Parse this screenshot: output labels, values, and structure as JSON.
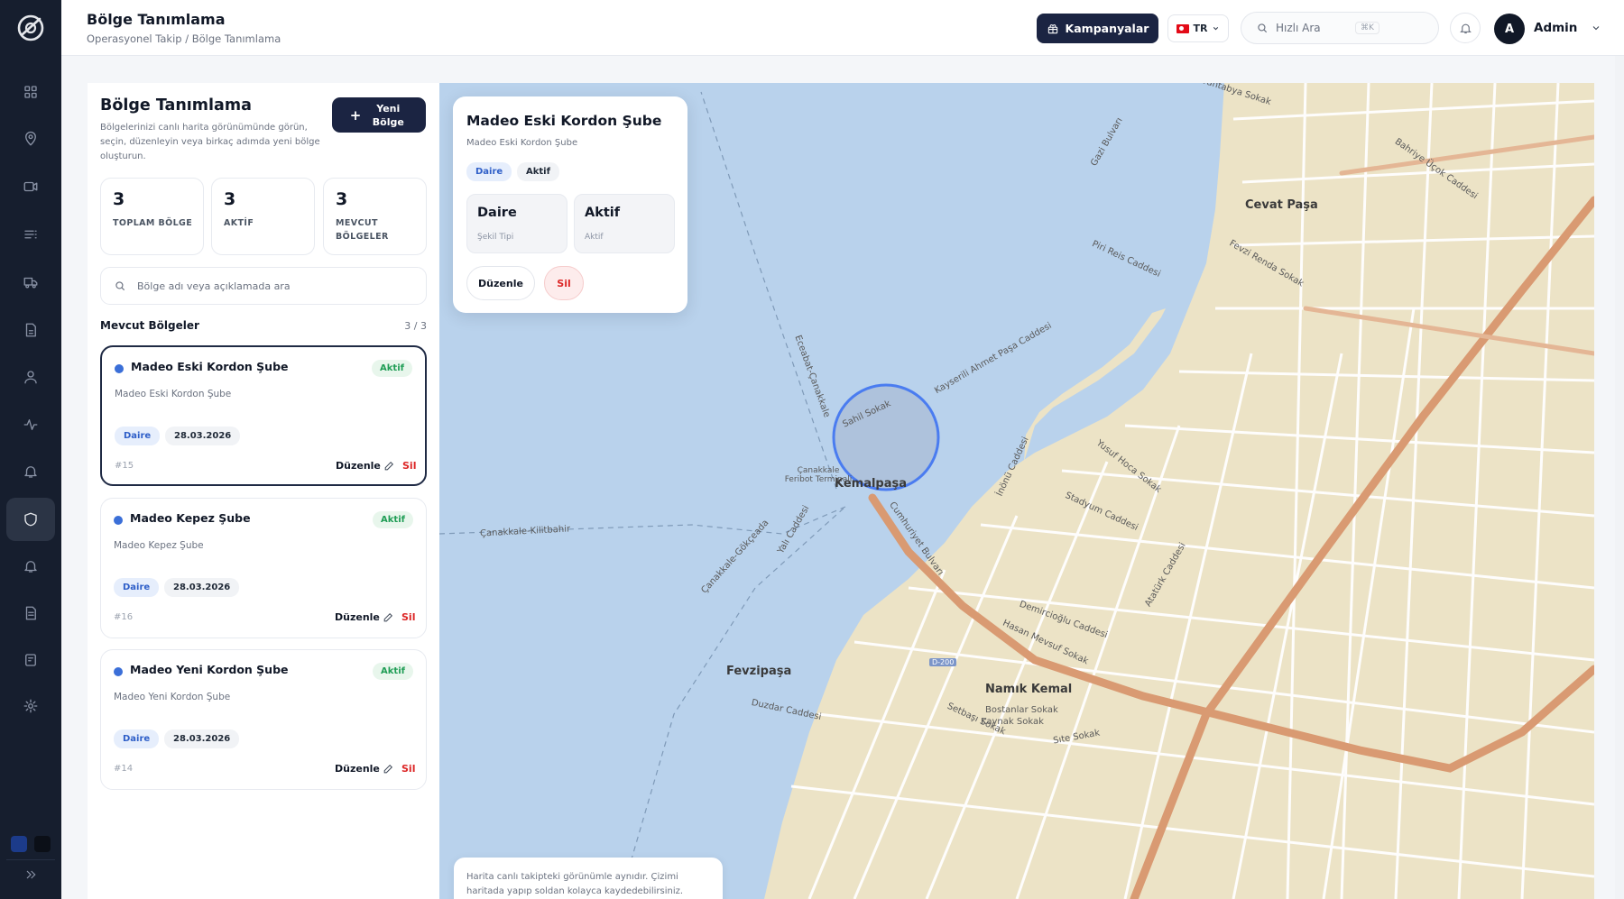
{
  "header": {
    "title": "Bölge Tanımlama",
    "breadcrumb": "Operasyonel Takip / Bölge Tanımlama",
    "campaign_label": "Kampanyalar",
    "language": "TR",
    "search_placeholder": "Hızlı Ara",
    "search_shortcut": "⌘K",
    "user_initial": "A",
    "user_name": "Admin"
  },
  "sidebar": {
    "items": [
      {
        "icon": "grid-icon"
      },
      {
        "icon": "location-pin-icon"
      },
      {
        "icon": "video-icon"
      },
      {
        "icon": "list-icon"
      },
      {
        "icon": "truck-icon"
      },
      {
        "icon": "document-icon"
      },
      {
        "icon": "user-icon"
      },
      {
        "icon": "activity-icon"
      },
      {
        "icon": "bell-icon"
      },
      {
        "icon": "shield-icon",
        "active": true
      },
      {
        "icon": "bell-alt-icon"
      },
      {
        "icon": "file-icon"
      },
      {
        "icon": "report-icon"
      },
      {
        "icon": "settings-icon"
      }
    ],
    "theme_colors": [
      "#1c3b8a",
      "#0b0f17"
    ]
  },
  "panel": {
    "title": "Bölge Tanımlama",
    "description": "Bölgelerinizi canlı harita görünümünde görün, seçin, düzenleyin veya birkaç adımda yeni bölge oluşturun.",
    "new_button": "Yeni Bölge",
    "stats": [
      {
        "value": "3",
        "label": "TOPLAM BÖLGE"
      },
      {
        "value": "3",
        "label": "AKTİF"
      },
      {
        "value": "3",
        "label": "MEVCUT BÖLGELER"
      }
    ],
    "search_placeholder": "Bölge adı veya açıklamada ara",
    "list_title": "Mevcut Bölgeler",
    "list_count": "3 / 3",
    "regions": [
      {
        "name": "Madeo Eski Kordon Şube",
        "status": "Aktif",
        "description": "Madeo Eski Kordon Şube",
        "type": "Daire",
        "date": "28.03.2026",
        "id": "#15",
        "edit": "Düzenle",
        "delete": "Sil"
      },
      {
        "name": "Madeo Kepez Şube",
        "status": "Aktif",
        "description": "Madeo Kepez Şube",
        "type": "Daire",
        "date": "28.03.2026",
        "id": "#16",
        "edit": "Düzenle",
        "delete": "Sil"
      },
      {
        "name": "Madeo Yeni Kordon Şube",
        "status": "Aktif",
        "description": "Madeo Yeni Kordon Şube",
        "type": "Daire",
        "date": "28.03.2026",
        "id": "#14",
        "edit": "Düzenle",
        "delete": "Sil"
      }
    ]
  },
  "popup": {
    "title": "Madeo Eski Kordon Şube",
    "subtitle": "Madeo Eski Kordon Şube",
    "chip_type": "Daire",
    "chip_status": "Aktif",
    "box1_value": "Daire",
    "box1_key": "Şekil Tipi",
    "box2_value": "Aktif",
    "box2_key": "Aktif",
    "edit": "Düzenle",
    "delete": "Sil"
  },
  "map": {
    "districts": [
      "Cevat Paşa",
      "Kemalpaşa",
      "Fevzipaşa",
      "Namık Kemal"
    ],
    "streets": [
      "Havantabya Sokak",
      "Gazi Bulvarı",
      "Bahriye Üçok Caddesi",
      "Piri Reis Caddesi",
      "Fevzi Renda Sokak",
      "Yalı Caddesi",
      "Cumhuriyet Bulvarı",
      "Demircioğlu Caddesi",
      "Atatürk Caddesi",
      "İnönü Caddesi",
      "Stadyum Caddesi",
      "Kayserili Ahmet Paşa Caddesi",
      "Sahil Sokak",
      "Çanakkale-Kilitbahir",
      "Çanakkale-Gökçeada",
      "Eceabat-Çanakkale",
      "Çanakkale Feribot Terminali",
      "Hasan Mevsuf Sokak",
      "Duzdar Caddesi",
      "Setbaşı Sokak",
      "D-200",
      "Sıte Sokak",
      "Bostanlar Sokak",
      "Kaynak Sokak",
      "Yusuf Hoca Sokak"
    ],
    "note": "Harita canlı takipteki görünümle aynıdır. Çizimi haritada yapıp soldan kolayca kaydedebilirsiniz."
  }
}
